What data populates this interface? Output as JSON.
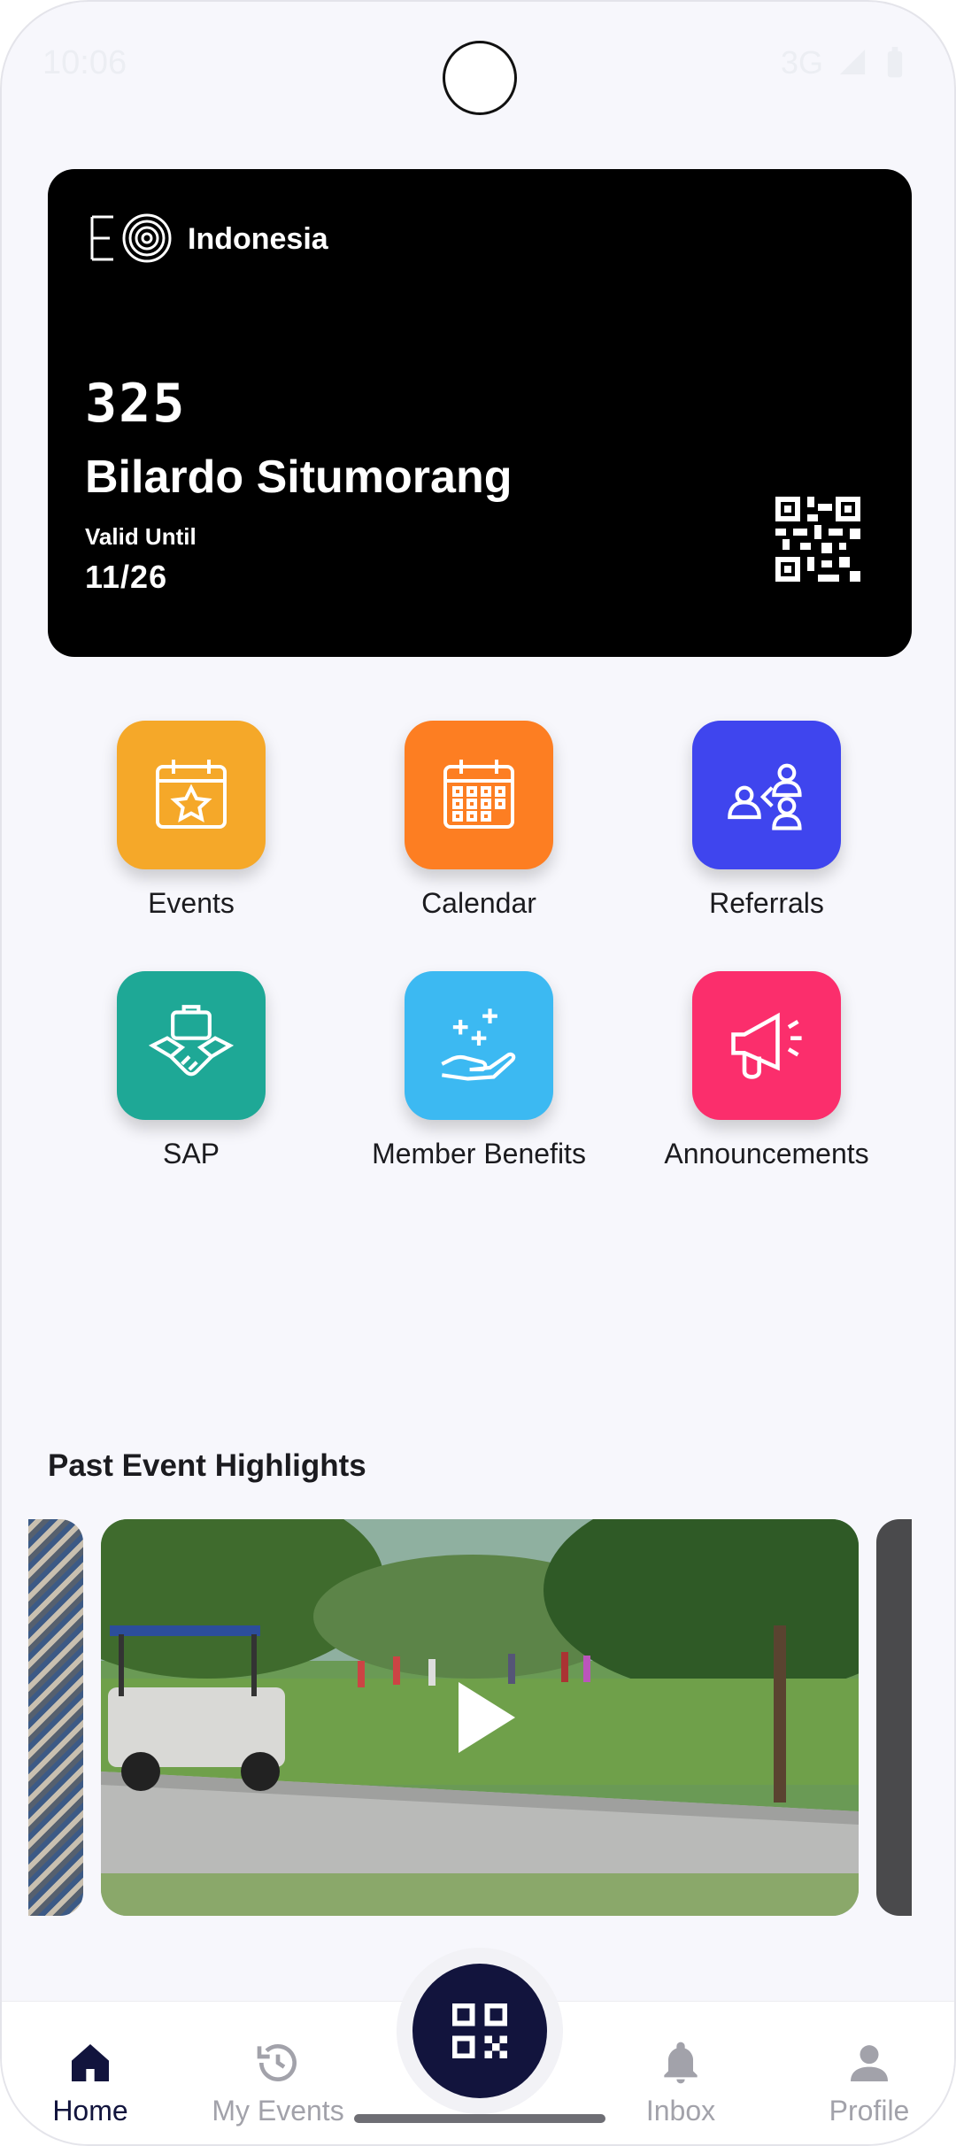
{
  "status_bar": {
    "time": "10:06",
    "network": "3G"
  },
  "card": {
    "chapter": "Indonesia",
    "number": "325",
    "name": "Bilardo Situmorang",
    "valid_label": "Valid Until",
    "valid_value": "11/26",
    "background": "#000000"
  },
  "shortcuts": [
    {
      "label": "Events",
      "icon": "calendar-star-icon",
      "color": "#f5a829"
    },
    {
      "label": "Calendar",
      "icon": "calendar-grid-icon",
      "color": "#fd7e22"
    },
    {
      "label": "Referrals",
      "icon": "referral-network-icon",
      "color": "#3f45ee"
    },
    {
      "label": "SAP",
      "icon": "handshake-briefcase-icon",
      "color": "#1ea896"
    },
    {
      "label": "Member Benefits",
      "icon": "hand-sparkles-icon",
      "color": "#3cb9f2"
    },
    {
      "label": "Announcements",
      "icon": "megaphone-icon",
      "color": "#fb2e6c"
    }
  ],
  "highlights": {
    "title": "Past Event Highlights",
    "items": [
      {
        "icon": "play-icon",
        "scene": "golf-course-video-thumbnail"
      }
    ]
  },
  "bottom_nav": {
    "items": [
      {
        "label": "Home",
        "icon": "home-icon",
        "active": true
      },
      {
        "label": "My Events",
        "icon": "history-icon",
        "active": false
      },
      {
        "label": "Inbox",
        "icon": "bell-icon",
        "active": false
      },
      {
        "label": "Profile",
        "icon": "person-icon",
        "active": false
      }
    ],
    "center_icon": "qr-code-icon",
    "active_color": "#12143d",
    "inactive_color": "#a2a2aa"
  }
}
